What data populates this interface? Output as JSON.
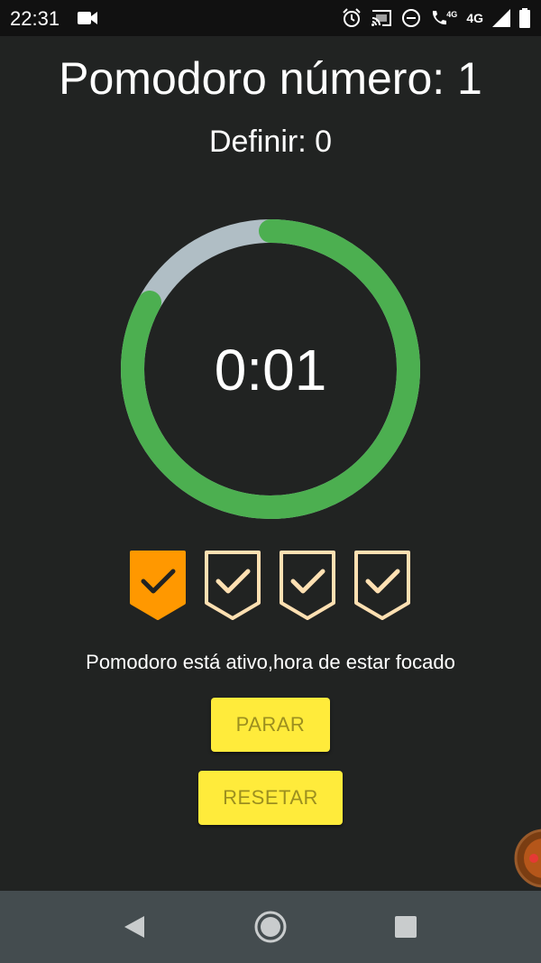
{
  "status_bar": {
    "time": "22:31",
    "icons": [
      "video-icon",
      "alarm-icon",
      "cast-icon",
      "do-not-disturb-icon",
      "wifi-calling-icon",
      "signal-icon",
      "battery-icon"
    ],
    "network_small": "4G",
    "network": "4G"
  },
  "header": {
    "title": "Pomodoro número: 1",
    "subtitle": "Definir: 0"
  },
  "timer": {
    "display": "0:01",
    "progress_remaining_fraction": 0.83,
    "colors": {
      "progress": "#4caf50",
      "track": "#b0bec5"
    }
  },
  "badges": {
    "total": 4,
    "active_index": 0,
    "colors": {
      "active_fill": "#ff9800",
      "active_check": "#212322",
      "inactive_stroke": "#ffe0b2"
    },
    "icon": "shield-check-icon"
  },
  "message": "Pomodoro está ativo,hora de estar focado",
  "buttons": {
    "stop_label": "PARAR",
    "reset_label": "RESETAR",
    "color": "#ffeb3b"
  },
  "nav_bar": {
    "icons": [
      "back-icon",
      "home-icon",
      "recents-icon"
    ]
  }
}
